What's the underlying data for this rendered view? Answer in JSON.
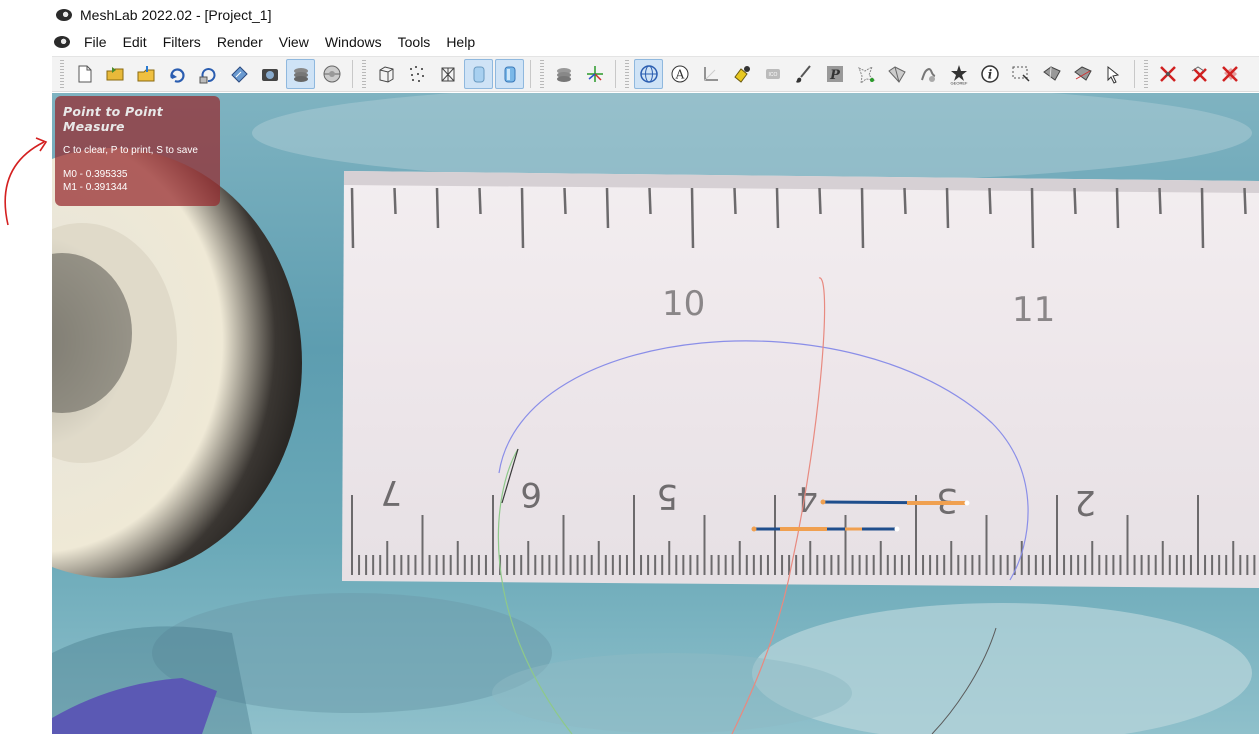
{
  "window": {
    "title": "MeshLab 2022.02 - [Project_1]"
  },
  "menubar": {
    "items": [
      "File",
      "Edit",
      "Filters",
      "Render",
      "View",
      "Windows",
      "Tools",
      "Help"
    ]
  },
  "toolbar": {
    "groups": [
      [
        "new-document-icon",
        "open-folder-icon",
        "import-mesh-icon",
        "reload-icon",
        "reload-all-icon",
        "save-icon",
        "snapshot-icon",
        "layers-icon",
        "project-icon"
      ],
      [
        "bounding-box-icon",
        "points-icon",
        "wireframe-icon",
        "flat-shading-icon",
        "smooth-shading-icon"
      ],
      [
        "raster-layers-icon",
        "axis-icon"
      ],
      [
        "manipulator-icon",
        "annotation-icon",
        "measure-tool-icon",
        "paint-bucket-icon",
        "align-icon",
        "brush-icon",
        "p-icon",
        "select-vertex-icon",
        "select-face-icon",
        "stroke-icon",
        "star-georef-icon",
        "info-icon",
        "select-rect-icon",
        "select-connected-icon",
        "select-plane-icon",
        "select-path-icon"
      ],
      [
        "delete-vertices-icon",
        "delete-faces-icon",
        "delete-selected-icon"
      ]
    ],
    "active": [
      "layers-icon",
      "flat-shading-icon",
      "smooth-shading-icon",
      "manipulator-icon"
    ],
    "georef_label": "GEOREF"
  },
  "measure": {
    "title": "Point to Point Measure",
    "hint": "C to clear, P to print, S to save",
    "values": [
      "M0 - 0.395335",
      "M1 - 0.391344"
    ]
  },
  "colors": {
    "panel": "#962d2d",
    "accent": "#f0a050",
    "measure_line": "#1f4e8c",
    "arc_blue": "#8a8ee8",
    "arc_red": "#e88a80"
  }
}
